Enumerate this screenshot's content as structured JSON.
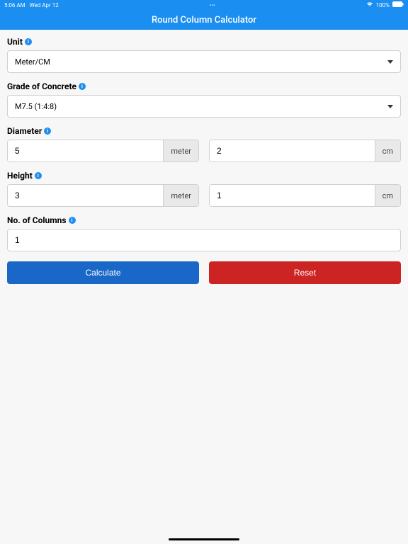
{
  "status": {
    "time": "5:06 AM",
    "date": "Wed Apr 12",
    "battery": "100%",
    "ellipsis": "•••"
  },
  "header": {
    "title": "Round Column Calculator"
  },
  "labels": {
    "unit": "Unit",
    "grade": "Grade of Concrete",
    "diameter": "Diameter",
    "height": "Height",
    "columns": "No. of Columns"
  },
  "values": {
    "unit_selected": "Meter/CM",
    "grade_selected": "M7.5 (1:4:8)",
    "diameter_major": "5",
    "diameter_minor": "2",
    "height_major": "3",
    "height_minor": "1",
    "columns": "1"
  },
  "units": {
    "major": "meter",
    "minor": "cm"
  },
  "buttons": {
    "calculate": "Calculate",
    "reset": "Reset"
  }
}
